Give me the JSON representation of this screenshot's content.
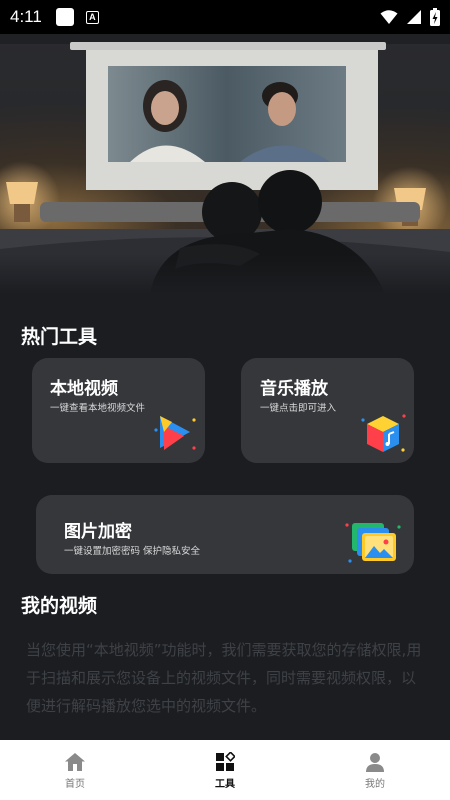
{
  "status_bar": {
    "time": "4:11"
  },
  "sections": {
    "hot_tools_title": "热门工具",
    "my_videos_title": "我的视频"
  },
  "tools": [
    {
      "title": "本地视频",
      "subtitle": "一键查看本地视频文件",
      "icon": "play-video-icon"
    },
    {
      "title": "音乐播放",
      "subtitle": "一键点击即可进入",
      "icon": "music-cube-icon"
    },
    {
      "title": "图片加密",
      "subtitle": "一键设置加密密码  保护隐私安全",
      "icon": "photo-gallery-icon"
    }
  ],
  "privacy_notice": "当您使用“本地视频”功能时，我们需要获取您的存储权限,用于扫描和展示您设备上的视频文件，同时需要视频权限，以便进行解码播放您选中的视频文件。",
  "bottom_nav": {
    "items": [
      {
        "label": "首页",
        "icon": "home-icon",
        "active": false
      },
      {
        "label": "工具",
        "icon": "tools-grid-icon",
        "active": true
      },
      {
        "label": "我的",
        "icon": "profile-icon",
        "active": false
      }
    ]
  },
  "colors": {
    "background": "#1b1d21",
    "card": "#35373b",
    "nav_background": "#ffffff"
  }
}
